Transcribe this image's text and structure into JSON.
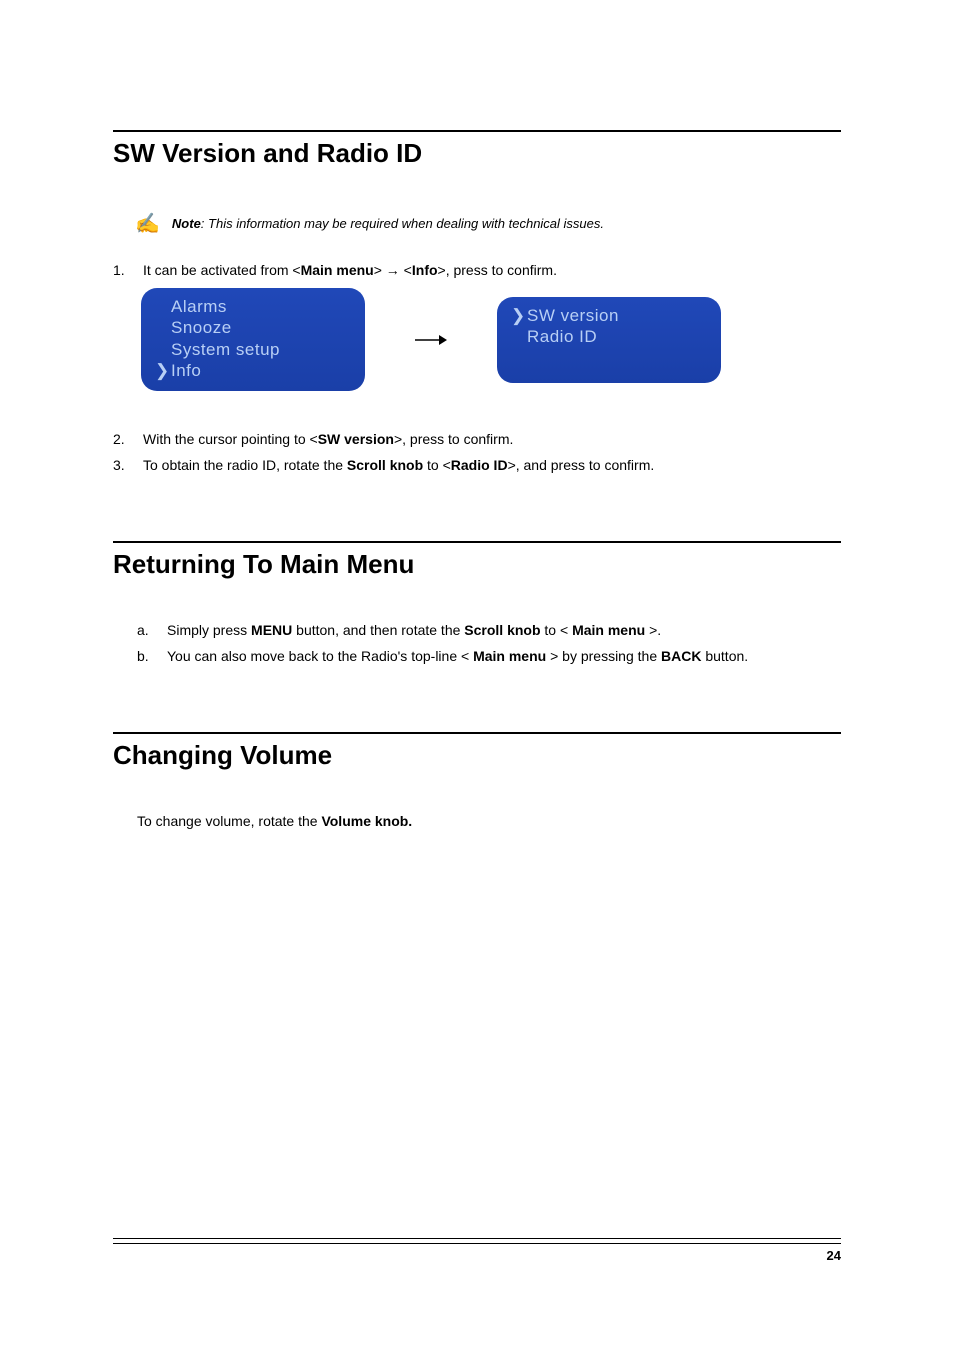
{
  "section1": {
    "title": "SW Version and Radio ID",
    "note": {
      "label": "Note",
      "body": ": This information may be required when dealing with technical issues."
    },
    "step1": {
      "prefix": "It can be activated from <",
      "t1": "Main menu",
      "mid1": "> ",
      "arrow": "→",
      "mid2": " <",
      "t2": "Info",
      "suffix": ">, press to confirm."
    },
    "lcd_left": {
      "l1": "Alarms",
      "l2": "Snooze",
      "l3": "System setup",
      "l4": "Info"
    },
    "lcd_right": {
      "l1": "SW version",
      "l2": "Radio ID"
    },
    "step2": {
      "prefix": "With the cursor pointing to <",
      "t1": "SW version",
      "suffix": ">, press to confirm."
    },
    "step3": {
      "prefix": "To obtain the radio ID, rotate the ",
      "t1": "Scroll knob",
      "mid": " to <",
      "t2": "Radio ID",
      "suffix": ">, and press to confirm."
    }
  },
  "section2": {
    "title": "Returning To Main Menu",
    "a": {
      "marker": "a.",
      "p1": "Simply press ",
      "t1": "MENU",
      "p2": " button, and then rotate the ",
      "t2": "Scroll knob",
      "p3": " to < ",
      "t3": "Main menu",
      "p4": " >."
    },
    "b": {
      "marker": "b.",
      "p1": "You can also move back to the Radio's top-line < ",
      "t1": "Main menu",
      "p2": " > by pressing the ",
      "t2": "BACK",
      "p3": " button."
    }
  },
  "section3": {
    "title": "Changing Volume",
    "body": {
      "p1": "To change volume, rotate the ",
      "t1": "Volume knob."
    }
  },
  "page_number": "24"
}
